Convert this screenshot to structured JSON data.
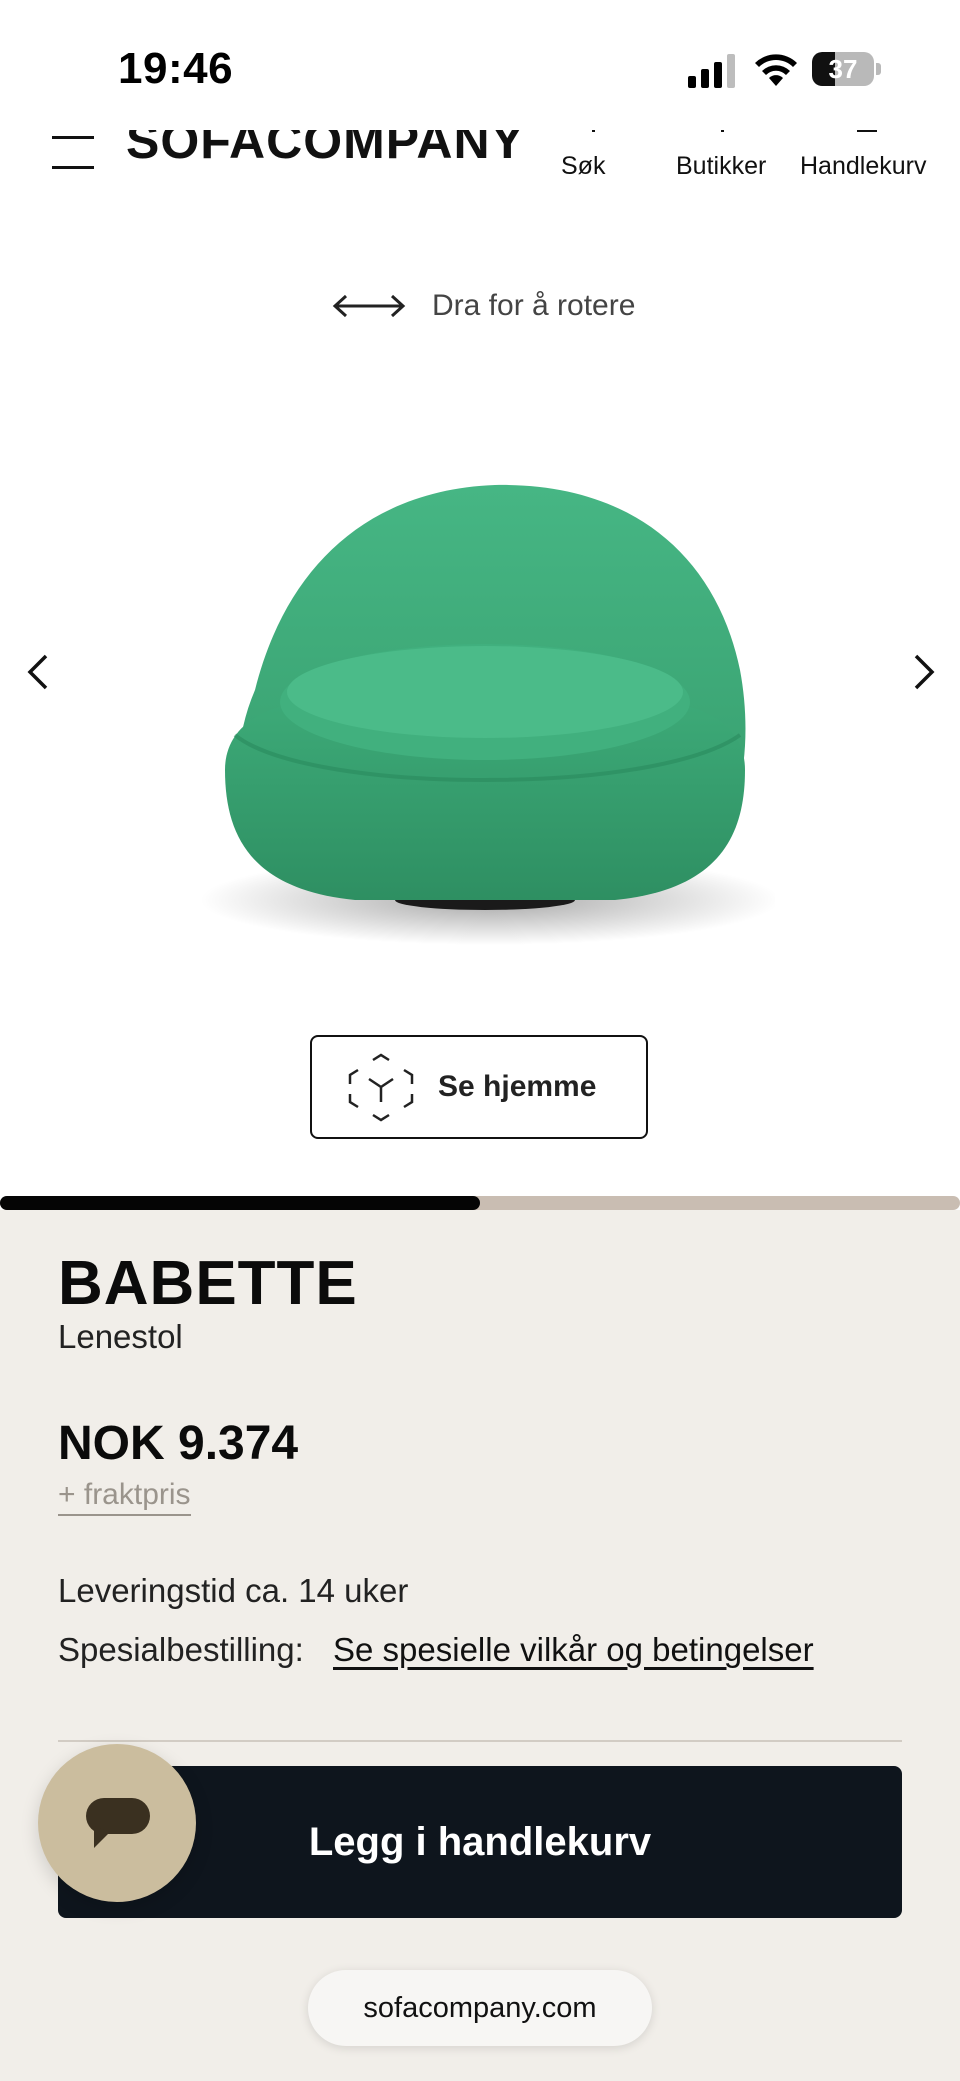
{
  "status_bar": {
    "time": "19:46",
    "battery": "37",
    "battery_percent": 37
  },
  "header": {
    "logo": "SOFACOMPANY",
    "nav": [
      {
        "label": "Søk",
        "icon": "search-icon"
      },
      {
        "label": "Butikker",
        "icon": "store-icon"
      },
      {
        "label": "Handlekurv",
        "icon": "cart-icon"
      }
    ]
  },
  "viewer": {
    "rotate_hint": "Dra for å rotere",
    "ar_button_label": "Se hjemme",
    "chair_color": "#3aa876",
    "carousel_progress": 0.5
  },
  "product": {
    "name": "BABETTE",
    "type": "Lenestol",
    "price": "NOK 9.374",
    "freight": "+ fraktpris",
    "delivery": "Leveringstid ca. 14 uker",
    "special_label": "Spesialbestilling:",
    "special_link": "Se spesielle vilkår og betingelser",
    "add_to_cart": "Legg i handlekurv"
  },
  "browser": {
    "url": "sofacompany.com"
  },
  "colors": {
    "panel_bg": "#f1eee9",
    "cart_button": "#0e151d",
    "chat_button": "#cbbd9e",
    "progress_track": "#c9bdb2"
  }
}
